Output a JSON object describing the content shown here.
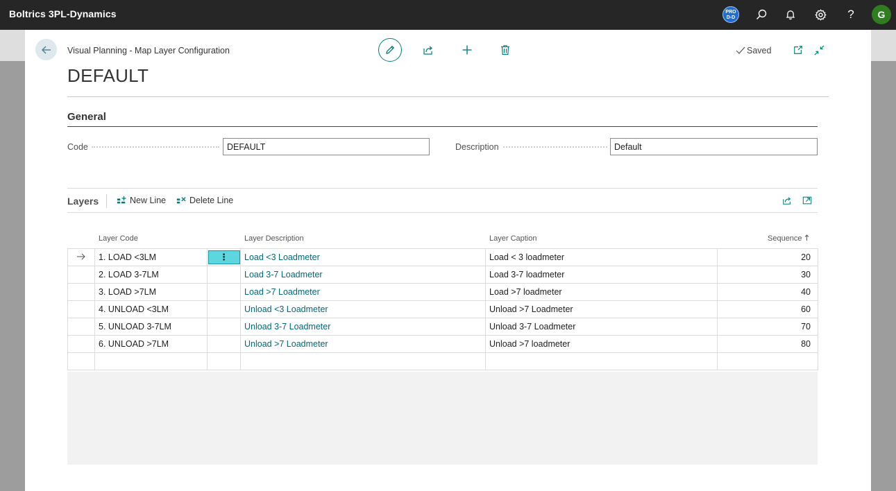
{
  "app": {
    "title": "Boltrics 3PL-Dynamics",
    "environment_badge": "PRO D-D",
    "avatar_initial": "G"
  },
  "header": {
    "breadcrumb": "Visual Planning - Map Layer Configuration",
    "page_title": "DEFAULT",
    "status": "Saved"
  },
  "general": {
    "title": "General",
    "code_label": "Code",
    "code_value": "DEFAULT",
    "description_label": "Description",
    "description_value": "Default"
  },
  "layers": {
    "title": "Layers",
    "new_line_label": "New Line",
    "delete_line_label": "Delete Line",
    "columns": {
      "code": "Layer Code",
      "description": "Layer Description",
      "caption": "Layer Caption",
      "sequence": "Sequence"
    },
    "rows": [
      {
        "code": "1. LOAD <3LM",
        "description": "Load <3 Loadmeter",
        "caption": "Load < 3 loadmeter",
        "sequence": "20"
      },
      {
        "code": "2. LOAD 3-7LM",
        "description": "Load 3-7 Loadmeter",
        "caption": "Load 3-7 loadmeter",
        "sequence": "30"
      },
      {
        "code": "3. LOAD >7LM",
        "description": "Load >7 Loadmeter",
        "caption": "Load >7 loadmeter",
        "sequence": "40"
      },
      {
        "code": "4. UNLOAD <3LM",
        "description": "Unload <3 Loadmeter",
        "caption": "Unload >7 Loadmeter",
        "sequence": "60"
      },
      {
        "code": "5. UNLOAD 3-7LM",
        "description": "Unload 3-7 Loadmeter",
        "caption": "Unload 3-7 Loadmeter",
        "sequence": "70"
      },
      {
        "code": "6. UNLOAD >7LM",
        "description": "Unload >7 Loadmeter",
        "caption": "Unload >7 loadmeter",
        "sequence": "80"
      }
    ]
  },
  "colors": {
    "accent": "#00807c",
    "link": "#00697a",
    "selected_cell": "#5ed6df",
    "appbar": "#262626"
  }
}
